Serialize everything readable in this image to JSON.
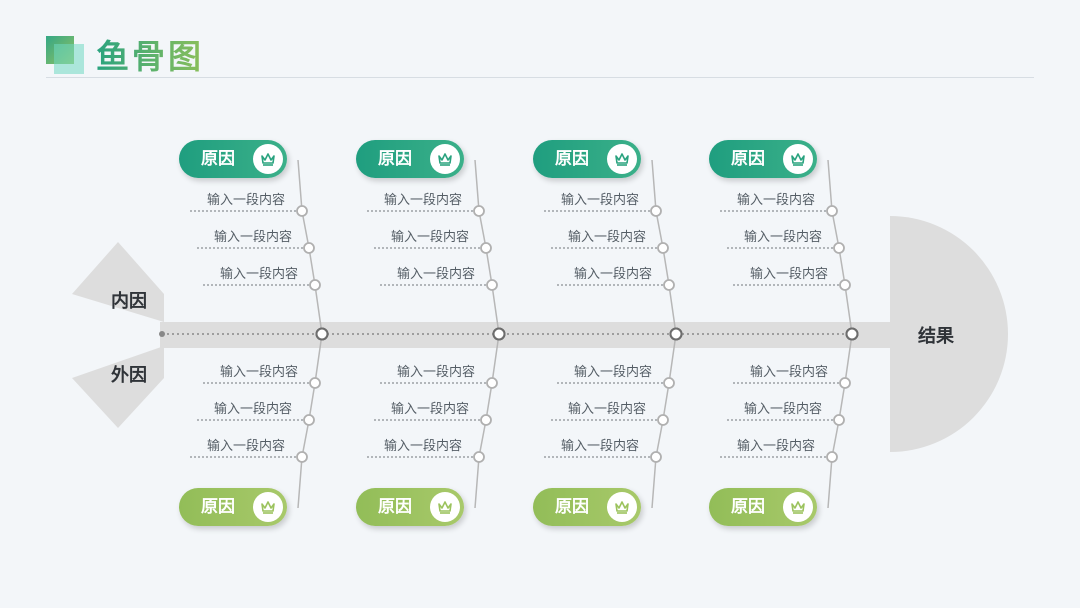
{
  "header": {
    "title": "鱼骨图"
  },
  "diagram": {
    "head_label": "结果",
    "tail_labels": [
      "内因",
      "外因"
    ],
    "top_branches": [
      {
        "label": "原因",
        "items": [
          "输入一段内容",
          "输入一段内容",
          "输入一段内容"
        ]
      },
      {
        "label": "原因",
        "items": [
          "输入一段内容",
          "输入一段内容",
          "输入一段内容"
        ]
      },
      {
        "label": "原因",
        "items": [
          "输入一段内容",
          "输入一段内容",
          "输入一段内容"
        ]
      },
      {
        "label": "原因",
        "items": [
          "输入一段内容",
          "输入一段内容",
          "输入一段内容"
        ]
      }
    ],
    "bottom_branches": [
      {
        "label": "原因",
        "items": [
          "输入一段内容",
          "输入一段内容",
          "输入一段内容"
        ]
      },
      {
        "label": "原因",
        "items": [
          "输入一段内容",
          "输入一段内容",
          "输入一段内容"
        ]
      },
      {
        "label": "原因",
        "items": [
          "输入一段内容",
          "输入一段内容",
          "输入一段内容"
        ]
      },
      {
        "label": "原因",
        "items": [
          "输入一段内容",
          "输入一段内容",
          "输入一段内容"
        ]
      }
    ]
  },
  "colors": {
    "top_pill": "#2aa37f",
    "bottom_pill": "#9cc35e",
    "bone": "#dddddd"
  },
  "icons": {
    "badge": "crown-icon"
  }
}
